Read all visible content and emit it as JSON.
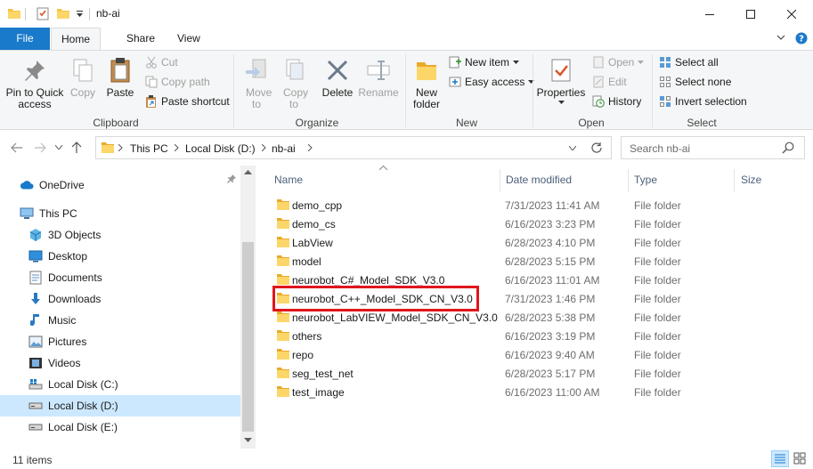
{
  "window": {
    "title": "nb-ai"
  },
  "tabs": {
    "file": "File",
    "home": "Home",
    "share": "Share",
    "view": "View"
  },
  "ribbon": {
    "clipboard": {
      "label": "Clipboard",
      "pin": "Pin to Quick access",
      "copy": "Copy",
      "paste": "Paste",
      "cut": "Cut",
      "copy_path": "Copy path",
      "paste_shortcut": "Paste shortcut"
    },
    "organize": {
      "label": "Organize",
      "move_to": "Move to",
      "copy_to": "Copy to",
      "delete": "Delete",
      "rename": "Rename"
    },
    "new": {
      "label": "New",
      "new_folder": "New folder",
      "new_item": "New item",
      "easy_access": "Easy access"
    },
    "open": {
      "label": "Open",
      "properties": "Properties",
      "open": "Open",
      "edit": "Edit",
      "history": "History"
    },
    "select": {
      "label": "Select",
      "select_all": "Select all",
      "select_none": "Select none",
      "invert": "Invert selection"
    }
  },
  "address": {
    "crumbs": [
      "This PC",
      "Local Disk (D:)",
      "nb-ai"
    ],
    "search_placeholder": "Search nb-ai"
  },
  "nav": {
    "onedrive": "OneDrive",
    "this_pc": "This PC",
    "objects3d": "3D Objects",
    "desktop": "Desktop",
    "documents": "Documents",
    "downloads": "Downloads",
    "music": "Music",
    "pictures": "Pictures",
    "videos": "Videos",
    "disk_c": "Local Disk (C:)",
    "disk_d": "Local Disk (D:)",
    "disk_e": "Local Disk (E:)"
  },
  "columns": {
    "name": "Name",
    "date": "Date modified",
    "type": "Type",
    "size": "Size"
  },
  "files": [
    {
      "name": "demo_cpp",
      "date": "7/31/2023 11:41 AM",
      "type": "File folder"
    },
    {
      "name": "demo_cs",
      "date": "6/16/2023 3:23 PM",
      "type": "File folder"
    },
    {
      "name": "LabView",
      "date": "6/28/2023 4:10 PM",
      "type": "File folder"
    },
    {
      "name": "model",
      "date": "6/28/2023 5:15 PM",
      "type": "File folder"
    },
    {
      "name": "neurobot_C#_Model_SDK_V3.0",
      "date": "6/16/2023 11:01 AM",
      "type": "File folder"
    },
    {
      "name": "neurobot_C++_Model_SDK_CN_V3.0",
      "date": "7/31/2023 1:46 PM",
      "type": "File folder"
    },
    {
      "name": "neurobot_LabVIEW_Model_SDK_CN_V3.0",
      "date": "6/28/2023 5:38 PM",
      "type": "File folder"
    },
    {
      "name": "others",
      "date": "6/16/2023 3:19 PM",
      "type": "File folder"
    },
    {
      "name": "repo",
      "date": "6/16/2023 9:40 AM",
      "type": "File folder"
    },
    {
      "name": "seg_test_net",
      "date": "6/28/2023 5:17 PM",
      "type": "File folder"
    },
    {
      "name": "test_image",
      "date": "6/16/2023 11:00 AM",
      "type": "File folder"
    }
  ],
  "status": {
    "count": "11 items"
  },
  "colors": {
    "accent": "#1979ca",
    "folder": "#f6c443",
    "selection": "#cce8ff",
    "highlight": "#e0161c"
  }
}
